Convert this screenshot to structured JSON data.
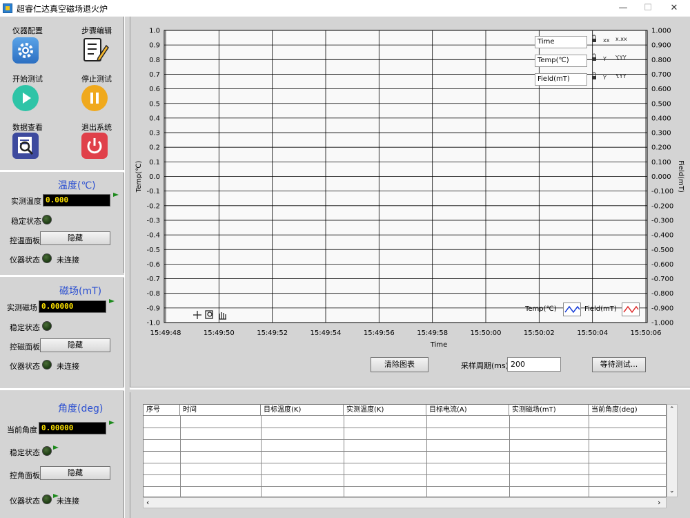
{
  "window": {
    "title": "超睿仁达真空磁场退火炉",
    "minimize": "—",
    "maximize": "☐",
    "close": "✕"
  },
  "toolbar": {
    "instrument_config": "仪器配置",
    "step_edit": "步骤编辑",
    "start_test": "开始测试",
    "stop_test": "停止测试",
    "data_view": "数据查看",
    "exit_system": "退出系统"
  },
  "temperature": {
    "title": "温度(℃)",
    "measured_label": "实测温度",
    "measured_value": "0.000",
    "stable_label": "稳定状态",
    "panel_label": "控温面板",
    "panel_button": "隐藏",
    "device_label": "仪器状态",
    "device_status": "未连接"
  },
  "field": {
    "title": "磁场(mT)",
    "measured_label": "实测磁场",
    "measured_value": "0.00000",
    "stable_label": "稳定状态",
    "panel_label": "控磁面板",
    "panel_button": "隐藏",
    "device_label": "仪器状态",
    "device_status": "未连接"
  },
  "angle": {
    "title": "角度(deg)",
    "current_label": "当前角度",
    "current_value": "0.00000",
    "stable_label": "稳定状态",
    "panel_label": "控角面板",
    "panel_button": "隐藏",
    "device_label": "仪器状态",
    "device_status": "未连接"
  },
  "chart_data": {
    "type": "line",
    "xlabel": "Time",
    "ylabel": "Temp(℃)",
    "y2label": "Field(mT)",
    "x_ticks": [
      "15:49:48",
      "15:49:50",
      "15:49:52",
      "15:49:54",
      "15:49:56",
      "15:49:58",
      "15:50:00",
      "15:50:02",
      "15:50:04",
      "15:50:06"
    ],
    "ylim": [
      -1.0,
      1.0
    ],
    "y_ticks": [
      "1.0",
      "0.9",
      "0.8",
      "0.7",
      "0.6",
      "0.5",
      "0.4",
      "0.3",
      "0.2",
      "0.1",
      "0.0",
      "-0.1",
      "-0.2",
      "-0.3",
      "-0.4",
      "-0.5",
      "-0.6",
      "-0.7",
      "-0.8",
      "-0.9",
      "-1.0"
    ],
    "y2lim": [
      -1.0,
      1.0
    ],
    "y2_ticks": [
      "1.000",
      "0.900",
      "0.800",
      "0.700",
      "0.600",
      "0.500",
      "0.400",
      "0.300",
      "0.200",
      "0.100",
      "0.000",
      "-0.100",
      "-0.200",
      "-0.300",
      "-0.400",
      "-0.500",
      "-0.600",
      "-0.700",
      "-0.800",
      "-0.900",
      "-1.000"
    ],
    "grid": true,
    "series": [
      {
        "name": "Temp(℃)",
        "color": "#1a3fd8",
        "values": []
      },
      {
        "name": "Field(mT)",
        "color": "#e03030",
        "values": []
      }
    ],
    "scale_legend": [
      "Time",
      "Temp(℃)",
      "Field(mT)"
    ]
  },
  "graph_controls": {
    "clear_button": "清除图表",
    "sample_label": "采样周期(ms)",
    "sample_value": "200",
    "wait_button": "等待测试..."
  },
  "table": {
    "columns": [
      "序号",
      "时间",
      "目标温度(K)",
      "实测温度(K)",
      "目标电流(A)",
      "实测磁场(mT)",
      "当前角度(deg)"
    ],
    "rows": []
  },
  "colors": {
    "section_title": "#2b4fd1",
    "number_text": "#ffe400",
    "led_off": "#1b3a12"
  }
}
